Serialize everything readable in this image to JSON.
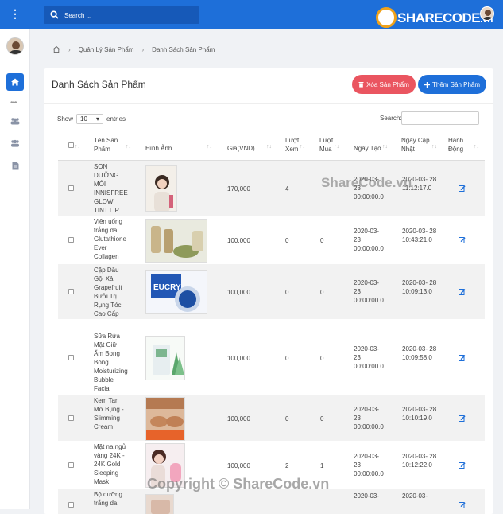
{
  "topbar": {
    "search_placeholder": "Search ..."
  },
  "logo": {
    "text": "SHARECODE",
    "suffix": ".vn"
  },
  "breadcrumb": {
    "items": [
      "Quản Lý Sản Phẩm",
      "Danh Sách Sản Phẩm"
    ]
  },
  "card": {
    "title": "Danh Sách Sản Phẩm",
    "delete_label": "Xóa Sản Phẩm",
    "add_label": "Thêm Sản Phẩm"
  },
  "table_controls": {
    "show_label": "Show",
    "entries_value": "10",
    "entries_label": "entries",
    "search_label": "Search:"
  },
  "columns": [
    "Tên Sản Phẩm",
    "Hình Ảnh",
    "Giá(VND)",
    "Lượt Xem",
    "Lượt Mua",
    "Ngày Tạo",
    "Ngày Cập Nhật",
    "Hành Động"
  ],
  "rows": [
    {
      "name": "SON DƯỠNG MÔI INNISFREE GLOW TINT LIP",
      "price": "170,000",
      "views": "4",
      "buys": "",
      "created": "2020-03- 23 00:00:00.0",
      "updated": "2020-03- 28 11:12:17.0"
    },
    {
      "name": "Viên uống trắng da Glutathione Ever Collagen",
      "price": "100,000",
      "views": "0",
      "buys": "0",
      "created": "2020-03- 23 00:00:00.0",
      "updated": "2020-03- 28 10:43:21.0"
    },
    {
      "name": "Cặp Dầu Gội Xả Grapefruit Bưởi Trị Rụng Tóc Cao Cấp",
      "price": "100,000",
      "views": "0",
      "buys": "0",
      "created": "2020-03- 23 00:00:00.0",
      "updated": "2020-03- 28 10:09:13.0"
    },
    {
      "name": "Sữa Rửa Mặt Giữ Ẩm Bong Bóng Moisturizing Bubble Facial Wash",
      "price": "100,000",
      "views": "0",
      "buys": "0",
      "created": "2020-03- 23 00:00:00.0",
      "updated": "2020-03- 28 10:09:58.0"
    },
    {
      "name": "Kem Tan Mỡ Bụng - Slimming Cream",
      "price": "100,000",
      "views": "0",
      "buys": "0",
      "created": "2020-03- 23 00:00:00.0",
      "updated": "2020-03- 28 10:10:19.0"
    },
    {
      "name": "Mặt na ngủ vàng 24K - 24K Gold Sleeping Mask",
      "price": "100,000",
      "views": "2",
      "buys": "1",
      "created": "2020-03- 23 00:00:00.0",
      "updated": "2020-03- 28 10:12:22.0"
    },
    {
      "name": "Bộ dưỡng trắng da",
      "price": "",
      "views": "",
      "buys": "",
      "created": "2020-03-",
      "updated": "2020-03-"
    }
  ],
  "watermarks": {
    "center": "ShareCode.vn",
    "bottom": "Copyright © ShareCode.vn"
  },
  "colors": {
    "primary": "#1e6fd9",
    "danger": "#ea5560"
  }
}
